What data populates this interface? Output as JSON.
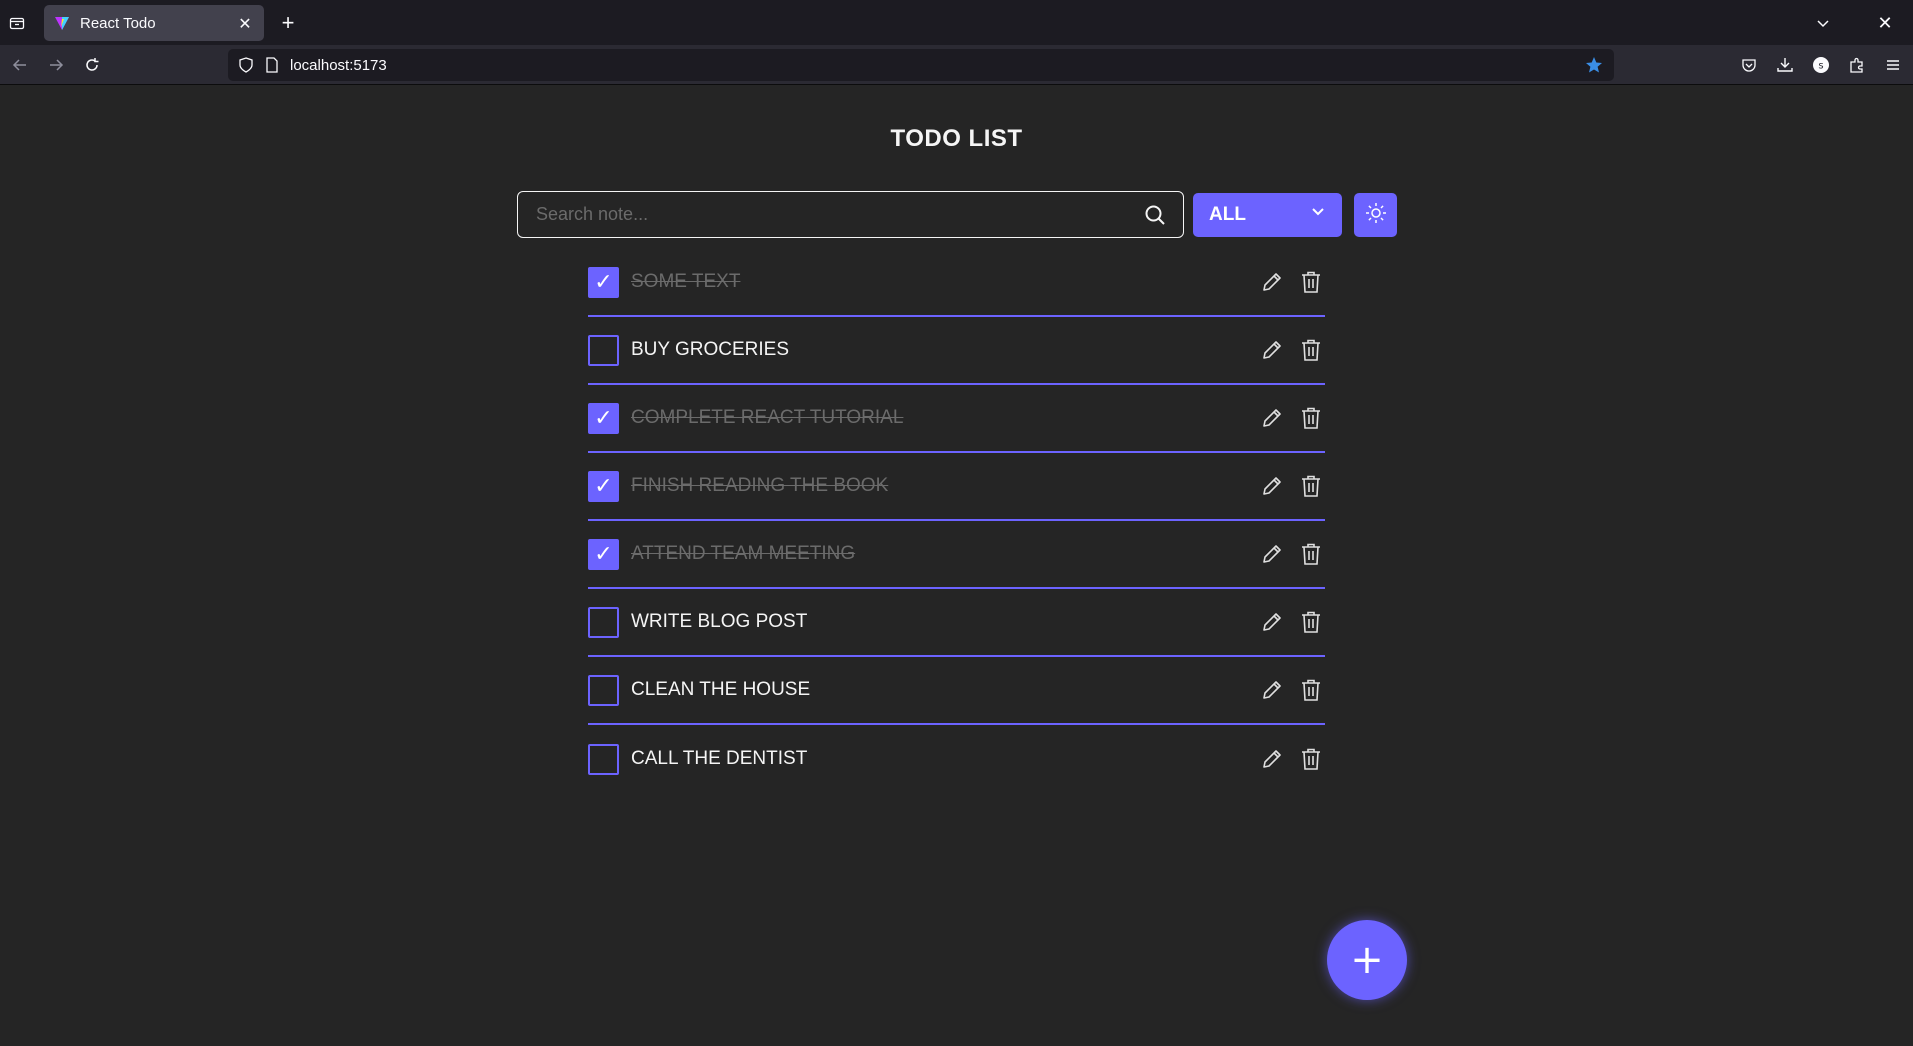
{
  "browser": {
    "tab_title": "React Todo",
    "url": "localhost:5173",
    "new_tab_icon": "plus-icon"
  },
  "app": {
    "title": "TODO LIST",
    "search": {
      "placeholder": "Search note...",
      "value": ""
    },
    "filter": {
      "selected": "ALL"
    },
    "add_button_label": "+"
  },
  "todos": [
    {
      "text": "SOME TEXT",
      "done": true
    },
    {
      "text": "BUY GROCERIES",
      "done": false
    },
    {
      "text": "COMPLETE REACT TUTORIAL",
      "done": true
    },
    {
      "text": "FINISH READING THE BOOK",
      "done": true
    },
    {
      "text": "ATTEND TEAM MEETING",
      "done": true
    },
    {
      "text": "WRITE BLOG POST",
      "done": false
    },
    {
      "text": "CLEAN THE HOUSE",
      "done": false
    },
    {
      "text": "CALL THE DENTIST",
      "done": false
    }
  ],
  "colors": {
    "accent": "#6c63ff",
    "background": "#252525",
    "text": "#f5f5f5",
    "done_text": "#6b6b6b"
  }
}
